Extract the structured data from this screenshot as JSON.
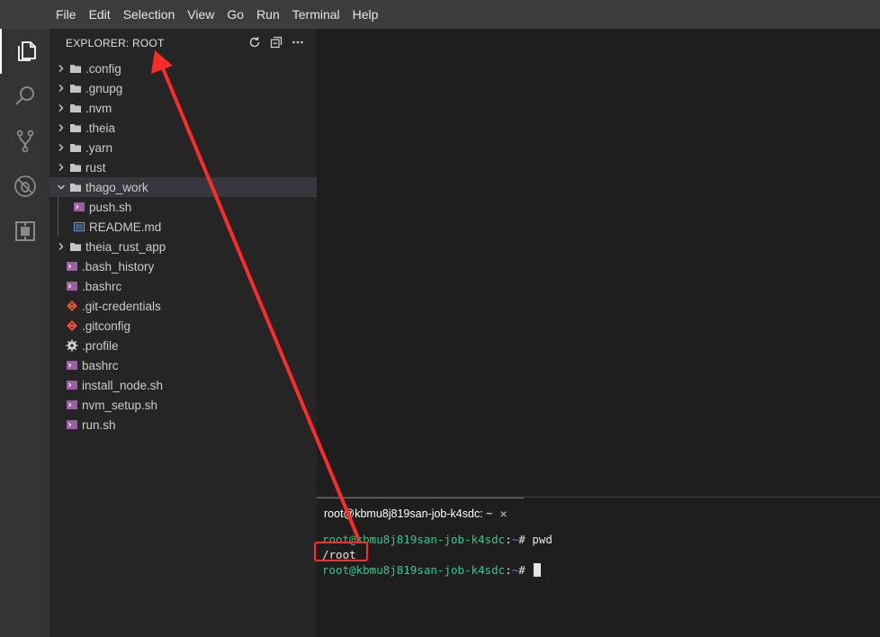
{
  "menubar": {
    "items": [
      "File",
      "Edit",
      "Selection",
      "View",
      "Go",
      "Run",
      "Terminal",
      "Help"
    ]
  },
  "activity_bar": {
    "items": [
      "files-icon",
      "search-icon",
      "source-control-icon",
      "debug-icon",
      "extensions-icon"
    ]
  },
  "explorer": {
    "title": "EXPLORER: ROOT",
    "actions": [
      "refresh-icon",
      "collapse-all-icon",
      "more-icon"
    ],
    "tree": [
      {
        "label": ".config",
        "type": "folder",
        "expanded": false,
        "depth": 0
      },
      {
        "label": ".gnupg",
        "type": "folder",
        "expanded": false,
        "depth": 0
      },
      {
        "label": ".nvm",
        "type": "folder",
        "expanded": false,
        "depth": 0
      },
      {
        "label": ".theia",
        "type": "folder",
        "expanded": false,
        "depth": 0
      },
      {
        "label": ".yarn",
        "type": "folder",
        "expanded": false,
        "depth": 0
      },
      {
        "label": "rust",
        "type": "folder",
        "expanded": false,
        "depth": 0
      },
      {
        "label": "thago_work",
        "type": "folder",
        "expanded": true,
        "depth": 0,
        "selected": true
      },
      {
        "label": "push.sh",
        "type": "shell",
        "depth": 1
      },
      {
        "label": "README.md",
        "type": "markdown",
        "depth": 1
      },
      {
        "label": "theia_rust_app",
        "type": "folder",
        "expanded": false,
        "depth": 0
      },
      {
        "label": ".bash_history",
        "type": "shell",
        "depth": 0
      },
      {
        "label": ".bashrc",
        "type": "shell",
        "depth": 0
      },
      {
        "label": ".git-credentials",
        "type": "git",
        "depth": 0
      },
      {
        "label": ".gitconfig",
        "type": "git",
        "depth": 0
      },
      {
        "label": ".profile",
        "type": "gear",
        "depth": 0
      },
      {
        "label": "bashrc",
        "type": "shell",
        "depth": 0
      },
      {
        "label": "install_node.sh",
        "type": "shell",
        "depth": 0
      },
      {
        "label": "nvm_setup.sh",
        "type": "shell",
        "depth": 0
      },
      {
        "label": "run.sh",
        "type": "shell",
        "depth": 0
      }
    ]
  },
  "terminal": {
    "tab_label": "root@kbmu8j819san-job-k4sdc: ~",
    "close_glyph": "×",
    "lines": [
      {
        "user_host": "root@kbmu8j819san-job-k4sdc",
        "sep": ":",
        "path": "~",
        "prompt": "# ",
        "cmd": "pwd"
      },
      {
        "output": "/root"
      },
      {
        "user_host": "root@kbmu8j819san-job-k4sdc",
        "sep": ":",
        "path": "~",
        "prompt": "# ",
        "cmd": ""
      }
    ]
  },
  "colors": {
    "annotation_red": "#ff2a2a",
    "terminal_green": "#23d18b",
    "terminal_blue": "#3b8eea",
    "shell_icon": "#9b5fa0",
    "git_icon": "#e0513c",
    "markdown_icon": "#6a8fc7"
  }
}
